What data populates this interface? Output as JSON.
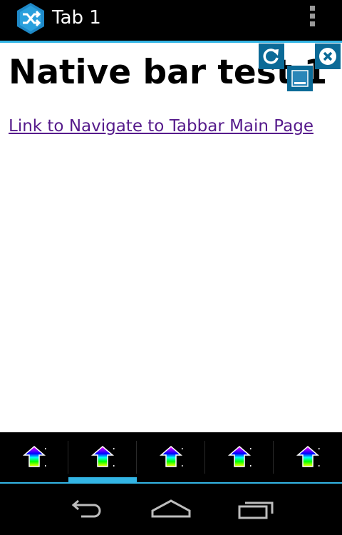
{
  "action_bar": {
    "title": "Tab 1",
    "icon": "shuffle-hexagon-icon",
    "overflow_icon": "overflow-menu-icon"
  },
  "content": {
    "heading": "Native bar test 1",
    "link": "Link to Navigate to Tabbar Main Page",
    "controls": [
      "refresh-icon",
      "minimize-icon",
      "close-icon"
    ]
  },
  "tabbar": {
    "selected_index": 1,
    "tabs": [
      {
        "icon": "rainbow-house-icon"
      },
      {
        "icon": "rainbow-house-icon"
      },
      {
        "icon": "rainbow-house-icon"
      },
      {
        "icon": "rainbow-house-icon"
      },
      {
        "icon": "rainbow-house-icon"
      }
    ]
  },
  "navbar": {
    "buttons": [
      "back-icon",
      "home-icon",
      "recent-apps-icon"
    ]
  },
  "colors": {
    "accent": "#33b5e5",
    "control_blue": "#0b6a97",
    "link": "#551a8b"
  }
}
